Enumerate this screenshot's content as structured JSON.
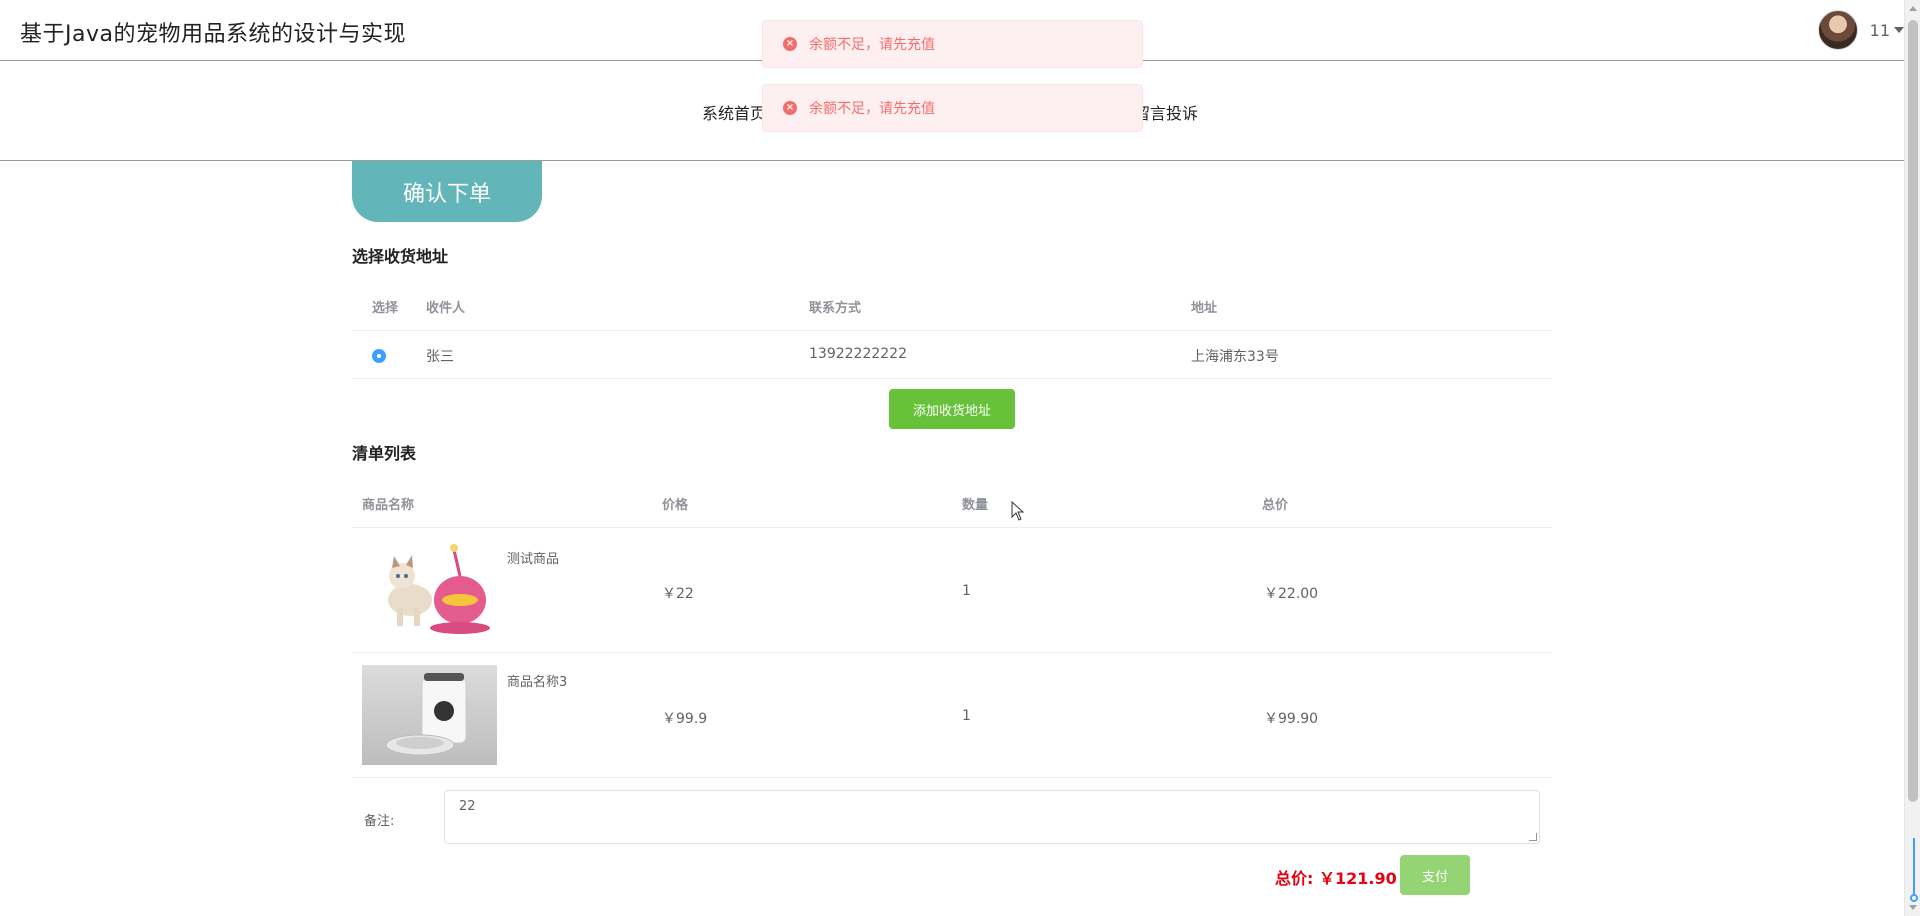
{
  "header": {
    "site_title": "基于Java的宠物用品系统的设计与实现",
    "username": "11"
  },
  "nav": {
    "items": [
      {
        "label": "系统首页"
      },
      {
        "label": "留言投诉"
      }
    ]
  },
  "toasts": [
    {
      "message": "余额不足，请先充值",
      "icon": "error-circle-icon"
    },
    {
      "message": "余额不足，请先充值",
      "icon": "error-circle-icon"
    }
  ],
  "page": {
    "tab_title": "确认下单",
    "address_section_title": "选择收货地址",
    "address_table": {
      "headers": [
        "选择",
        "收件人",
        "联系方式",
        "地址"
      ],
      "rows": [
        {
          "selected": true,
          "name": "张三",
          "phone": "13922222222",
          "address": "上海浦东33号"
        }
      ]
    },
    "add_address_label": "添加收货地址",
    "list_section_title": "清单列表",
    "items_table": {
      "headers": [
        "商品名称",
        "价格",
        "数量",
        "总价"
      ],
      "rows": [
        {
          "name": "测试商品",
          "price": "￥22",
          "qty": "1",
          "total": "￥22.00"
        },
        {
          "name": "商品名称3",
          "price": "￥99.9",
          "qty": "1",
          "total": "￥99.90"
        }
      ]
    },
    "remark_label": "备注:",
    "remark_value": "22",
    "total_label": "总价: ￥121.90",
    "pay_label": "支付"
  },
  "colors": {
    "accent": "#62b5b8",
    "green": "#67c23a",
    "error": "#f56c6c",
    "total_red": "#e60012"
  }
}
